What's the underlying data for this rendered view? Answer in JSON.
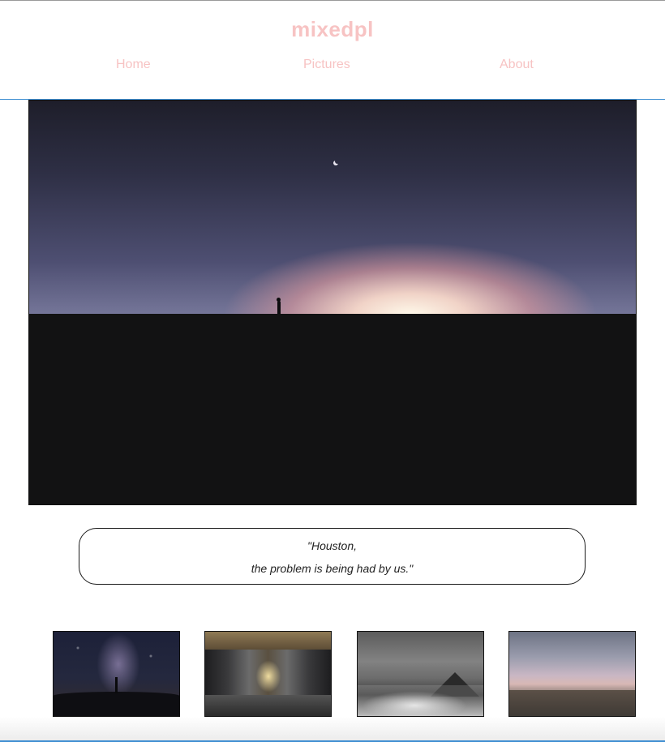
{
  "header": {
    "logo": "mixedpl",
    "nav": [
      {
        "label": "Home"
      },
      {
        "label": "Pictures"
      },
      {
        "label": "About"
      }
    ]
  },
  "quote": {
    "line1": "\"Houston,",
    "line2": "the problem is being had by us.\""
  },
  "colors": {
    "brand_pink": "#f7c3c3",
    "accent_blue": "#3f8fd2"
  }
}
